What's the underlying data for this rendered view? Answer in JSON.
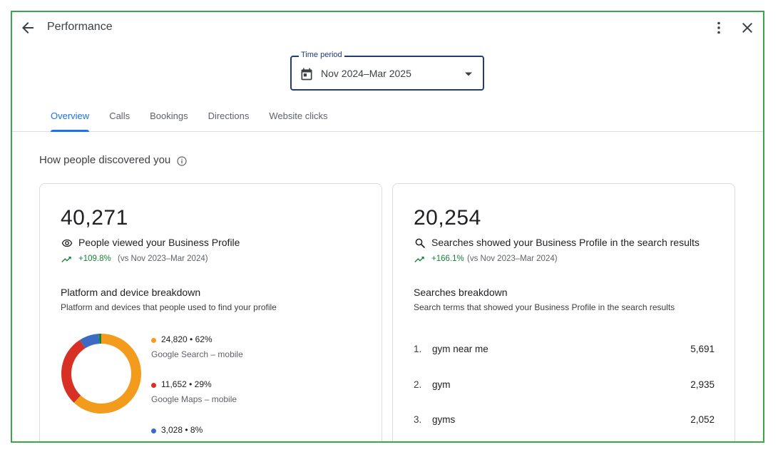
{
  "header": {
    "title": "Performance",
    "time_period": {
      "label": "Time period",
      "value": "Nov 2024–Mar 2025"
    },
    "tabs": [
      {
        "label": "Overview",
        "active": true
      },
      {
        "label": "Calls",
        "active": false
      },
      {
        "label": "Bookings",
        "active": false
      },
      {
        "label": "Directions",
        "active": false
      },
      {
        "label": "Website clicks",
        "active": false
      }
    ]
  },
  "section": {
    "title": "How people discovered you"
  },
  "views_card": {
    "value": "40,271",
    "label": "People viewed your Business Profile",
    "change": "+109.8%",
    "comparison": "(vs Nov 2023–Mar 2024)",
    "breakdown_title": "Platform and device breakdown",
    "breakdown_desc": "Platform and devices that people used to find your profile",
    "segments": [
      {
        "value": "24,820 • 62%",
        "name": "Google Search – mobile",
        "color": "#f29b1d",
        "share": 0.62
      },
      {
        "value": "11,652 • 29%",
        "name": "Google Maps – mobile",
        "color": "#d93025",
        "share": 0.29
      },
      {
        "value": "3,028 • 8%",
        "name": "",
        "color": "#3c6bc4",
        "share": 0.08
      },
      {
        "value": "",
        "name": "",
        "color": "#188038",
        "share": 0.01
      }
    ]
  },
  "searches_card": {
    "value": "20,254",
    "label": "Searches showed your Business Profile in the search results",
    "change": "+166.1%",
    "comparison": "(vs Nov 2023–Mar 2024)",
    "breakdown_title": "Searches breakdown",
    "breakdown_desc": "Search terms that showed your Business Profile in the search results",
    "terms": [
      {
        "rank": "1.",
        "term": "gym near me",
        "count": "5,691"
      },
      {
        "rank": "2.",
        "term": "gym",
        "count": "2,935"
      },
      {
        "rank": "3.",
        "term": "gyms",
        "count": "2,052"
      }
    ]
  },
  "colors": {
    "accent": "#1a73e8",
    "positive": "#188038",
    "border": "#3aa648"
  }
}
